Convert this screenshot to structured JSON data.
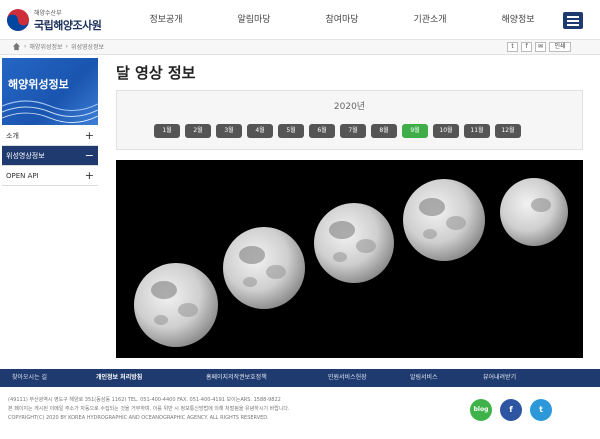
{
  "header": {
    "logo_sub": "해양수산부",
    "logo_main": "국립해양조사원",
    "nav": [
      "정보공개",
      "알림마당",
      "참여마당",
      "기관소개",
      "해양정보"
    ]
  },
  "breadcrumb": [
    "해양위성정보",
    "위성영상정보"
  ],
  "share": {
    "twitter": "t",
    "facebook": "f",
    "email": "✉",
    "print": "인쇄"
  },
  "sidebar": {
    "banner_title": "해양위성정보",
    "items": [
      {
        "label": "소개",
        "toggle": "+"
      },
      {
        "label": "위성영상정보",
        "toggle": "−"
      },
      {
        "label": "OPEN API",
        "toggle": "+"
      }
    ]
  },
  "main": {
    "title": "달 영상 정보",
    "year": "2020년",
    "months": [
      "1월",
      "2월",
      "3월",
      "4월",
      "5월",
      "6월",
      "7월",
      "8월",
      "9월",
      "10월",
      "11월",
      "12월"
    ],
    "selected_month": "9월"
  },
  "footer": {
    "links": [
      "찾아오시는 길",
      "개인정보 처리방침",
      "홈페이지저작권보호정책",
      "민원서비스헌장",
      "알림서비스",
      "뷰어내려받기"
    ],
    "address": "(49111) 부산광역시 영도구 해양로 351(동삼동 1162)   TEL. 051-400-4400   FAX. 051-400-4191   보이는ARS. 1588-9822",
    "notice": "본 페이지는 게시된 이메일 주소가 자동으로 수집되는 것을 거부하며, 이를 위반 시 정보통신망법에 의해 처벌됨을 유념하시기 바랍니다.",
    "copyright": "COPYRIGHT(C) 2020 BY KOREA HYDROGRAPHIC AND OCEANOGRAPHIC AGENCY. ALL RIGHTS RESERVED.",
    "sns": {
      "blog": "blog",
      "facebook": "f",
      "twitter": "t"
    }
  },
  "colors": {
    "navy": "#1f3a6e",
    "active_month": "#3fae49",
    "banner": "#2566c4"
  }
}
